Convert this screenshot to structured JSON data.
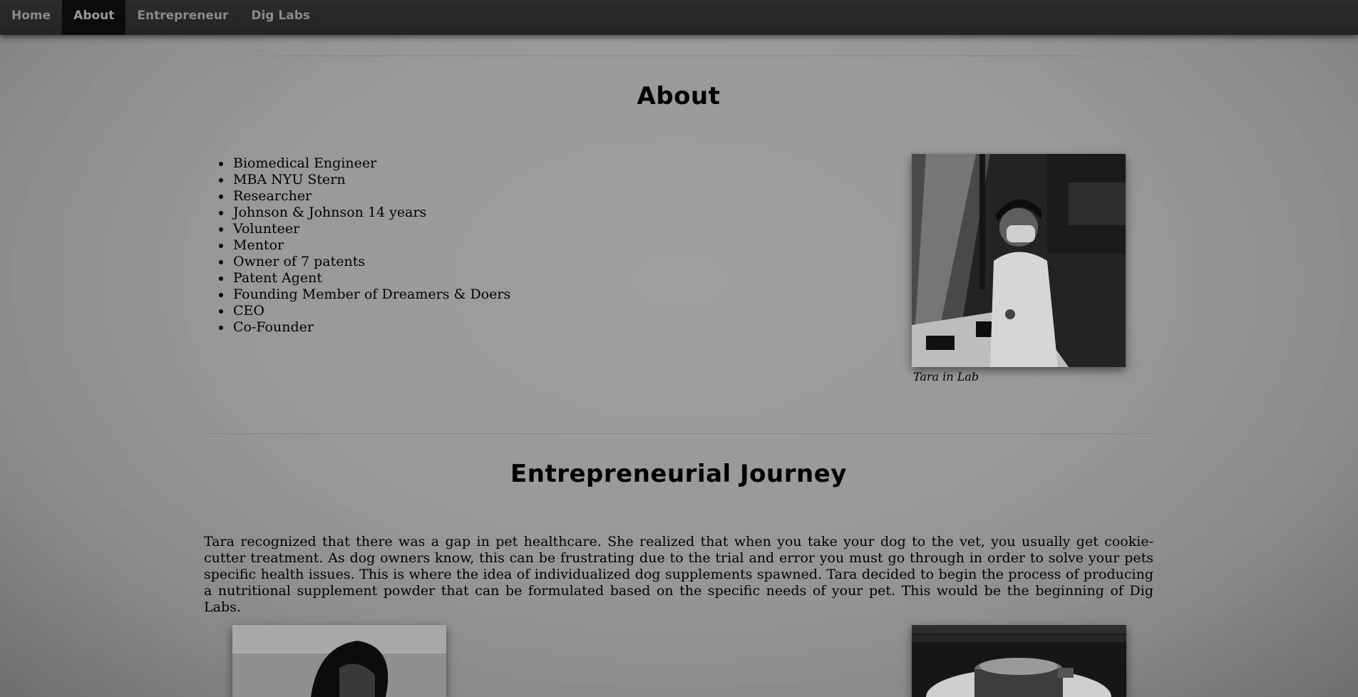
{
  "nav": {
    "items": [
      {
        "label": "Home",
        "active": false
      },
      {
        "label": "About",
        "active": true
      },
      {
        "label": "Entrepreneur",
        "active": false
      },
      {
        "label": "Dig Labs",
        "active": false
      }
    ]
  },
  "about": {
    "title": "About",
    "facts": [
      "Biomedical Engineer",
      "MBA NYU Stern",
      "Researcher",
      "Johnson & Johnson 14 years",
      "Volunteer",
      "Mentor",
      "Owner of 7 patents",
      "Patent Agent",
      "Founding Member of Dreamers & Doers",
      "CEO",
      "Co-Founder"
    ],
    "photo_caption": "Tara in Lab"
  },
  "journey": {
    "title": "Entrepreneurial Journey",
    "paragraph": "Tara recognized that there was a gap in pet healthcare. She realized that when you take your dog to the vet, you usually get cookie-cutter treatment. As dog owners know, this can be frustrating due to the trial and error you must go through in order to solve your pets specific health issues. This is where the idea of individualized dog supplements spawned. Tara decided to begin the process of producing a nutritional supplement powder that can be formulated based on the specific needs of your pet. This would be the beginning of Dig Labs."
  },
  "colors": {
    "nav_bg": "#262626",
    "nav_active_bg": "#0b0b0b",
    "nav_text": "#8a8a8a",
    "page_bg": "#999999"
  }
}
